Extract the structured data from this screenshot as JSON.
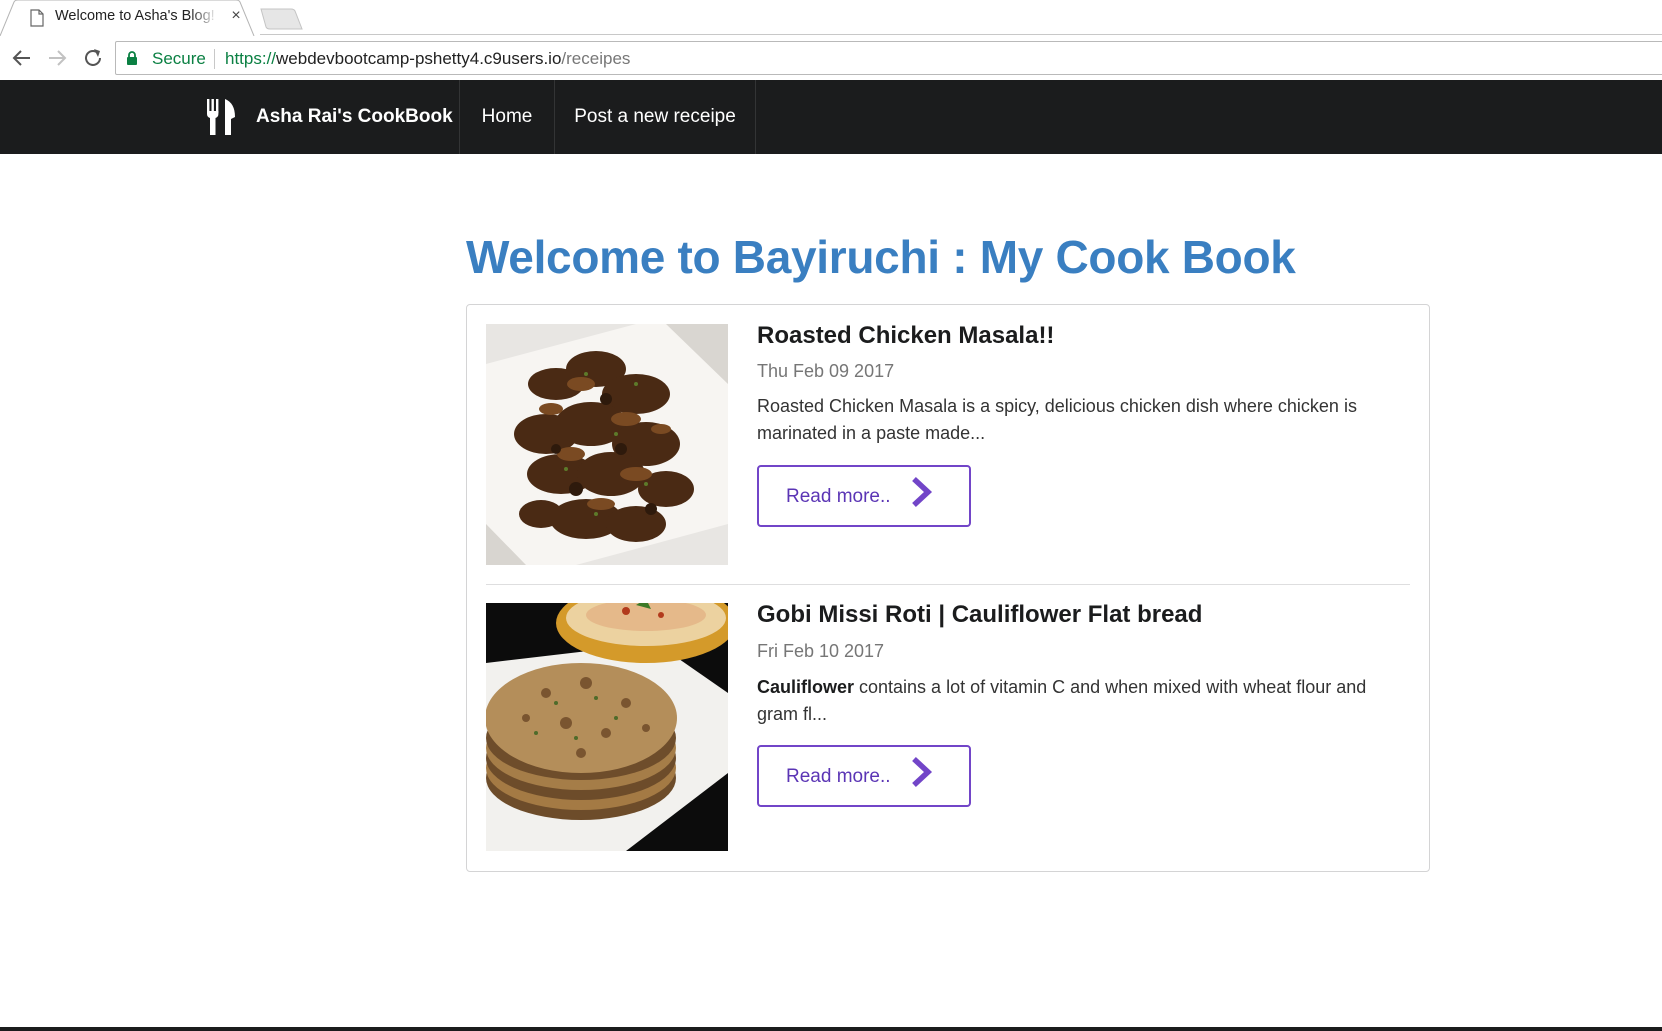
{
  "browser": {
    "tab_title": "Welcome to Asha's Blog!",
    "tab_close": "×",
    "secure_label": "Secure",
    "url_scheme": "https://",
    "url_host": "webdevbootcamp-pshetty4.c9users.io",
    "url_path": "/receipes"
  },
  "navbar": {
    "brand": "Asha Rai's CookBook",
    "brand_icon": "utensils-icon",
    "items": [
      {
        "label": "Home"
      },
      {
        "label": "Post a new receipe"
      }
    ]
  },
  "main": {
    "title": "Welcome to Bayiruchi : My Cook Book",
    "recipes": [
      {
        "title": "Roasted Chicken Masala!!",
        "date": "Thu Feb 09 2017",
        "description": "Roasted Chicken Masala is a spicy, delicious chicken dish where chicken is marinated in a paste made...",
        "button": "Read more..",
        "image": "roasted-chicken-photo"
      },
      {
        "title": "Gobi Missi Roti | Cauliflower Flat bread",
        "date": "Fri Feb 10 2017",
        "description_bold": "Cauliflower",
        "description": " contains a lot of vitamin C and when mixed with wheat flour and gram fl...",
        "button": "Read more..",
        "image": "flatbread-photo"
      }
    ]
  },
  "colors": {
    "title_blue": "#3a7fc1",
    "navbar_bg": "#1b1c1d",
    "button_purple": "#7245c8",
    "secure_green": "#0b8043"
  }
}
